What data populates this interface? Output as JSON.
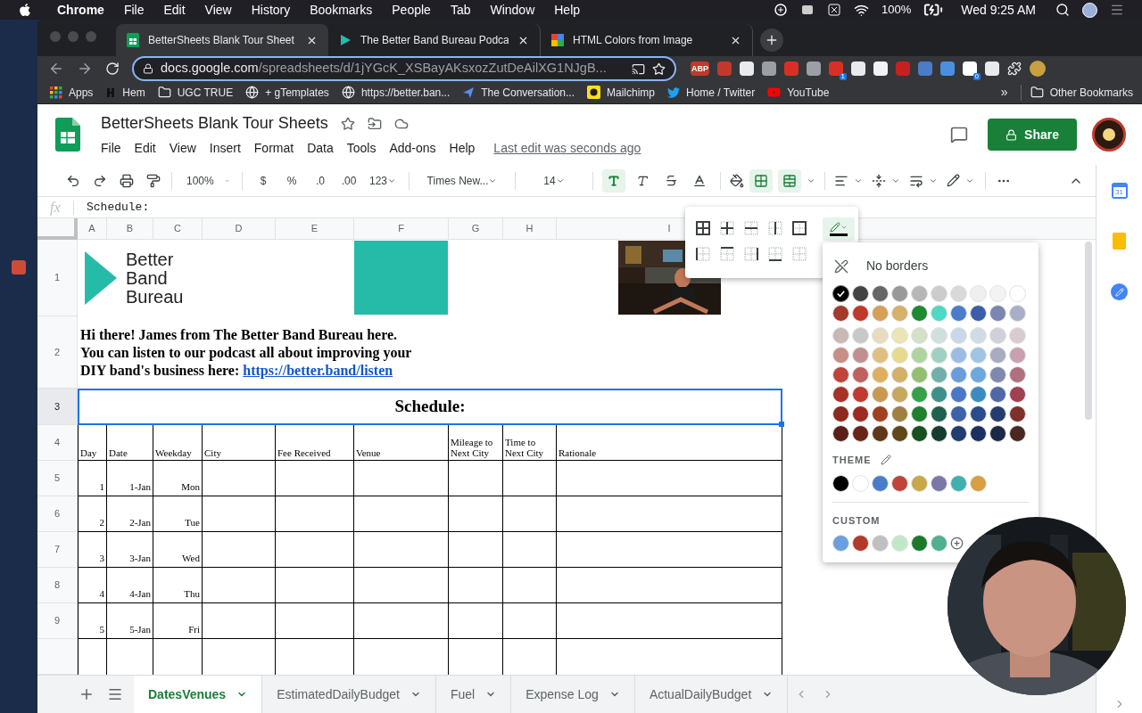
{
  "menubar": {
    "app": "Chrome",
    "menus": [
      "File",
      "Edit",
      "View",
      "History",
      "Bookmarks",
      "People",
      "Tab",
      "Window",
      "Help"
    ],
    "battery": "100%",
    "clock": "Wed 9:25 AM"
  },
  "browser": {
    "tabs": [
      {
        "title": "BetterSheets Blank Tour Sheet",
        "selected": true,
        "kind": "sheets"
      },
      {
        "title": "The Better Band Bureau Podca",
        "selected": false,
        "kind": "play"
      },
      {
        "title": "HTML Colors from Image",
        "selected": false,
        "kind": "colors"
      }
    ],
    "url_host": "docs.google.com",
    "url_path": "/spreadsheets/d/1jYGcK_XSBayAKsxozZutDeAilXG1NJgB...",
    "extensions": [
      {
        "color": "#c0392b",
        "label": "ABP"
      },
      {
        "color": "#c0392b"
      },
      {
        "color": "#e8eaed"
      },
      {
        "color": "#9aa0a6"
      },
      {
        "color": "#d93025"
      },
      {
        "color": "#9aa0a6"
      },
      {
        "color": "#d93025",
        "badge": "1"
      },
      {
        "color": "#e8eaed"
      },
      {
        "color": "#f1f3f4"
      },
      {
        "color": "#c5221f"
      },
      {
        "color": "#4a7cc8"
      },
      {
        "color": "#4a90e2"
      },
      {
        "color": "#ffffff",
        "badge": "0"
      },
      {
        "color": "#e8eaed"
      }
    ],
    "bookmarks": [
      {
        "label": "Apps",
        "kind": "apps"
      },
      {
        "label": "Hem",
        "kind": "mark"
      },
      {
        "label": "UGC TRUE",
        "kind": "folder"
      },
      {
        "label": "+ gTemplates",
        "kind": "globe"
      },
      {
        "label": "https://better.ban...",
        "kind": "globe"
      },
      {
        "label": "The Conversation...",
        "kind": "arrow"
      },
      {
        "label": "Mailchimp",
        "kind": "mail"
      },
      {
        "label": "Home / Twitter",
        "kind": "bird"
      },
      {
        "label": "YouTube",
        "kind": "play"
      }
    ],
    "bookmarks_more": "»",
    "other_bookmarks": "Other Bookmarks"
  },
  "doc": {
    "title": "BetterSheets Blank Tour Sheets",
    "menus": [
      "File",
      "Edit",
      "View",
      "Insert",
      "Format",
      "Data",
      "Tools",
      "Add-ons",
      "Help"
    ],
    "last_edit": "Last edit was seconds ago",
    "share": "Share"
  },
  "toolbar": {
    "zoom": "100%",
    "currency": "$",
    "percent": "%",
    "decimal_less": ".0",
    "decimal_more": ".00",
    "number_format": "123",
    "font": "Times New...",
    "size": "14",
    "bold": true,
    "italic": false,
    "strikethrough": false,
    "borders": true,
    "merge": true
  },
  "formula": {
    "fx": "fx",
    "value": "Schedule:"
  },
  "columns": [
    "A",
    "B",
    "C",
    "D",
    "E",
    "F",
    "G",
    "H",
    "I"
  ],
  "row_numbers": [
    {
      "label": "1",
      "selected": false
    },
    {
      "label": "2",
      "selected": false
    },
    {
      "label": "3",
      "selected": true
    },
    {
      "label": "4",
      "selected": false
    },
    {
      "label": "5",
      "selected": false
    },
    {
      "label": "6",
      "selected": false
    },
    {
      "label": "7",
      "selected": false
    },
    {
      "label": "8",
      "selected": false
    },
    {
      "label": "9",
      "selected": false
    }
  ],
  "logo": "Better Band Bureau",
  "intro": {
    "text": "Hi there! James from The Better Band Bureau here. You can listen to our podcast all about improving your DIY band's business here:",
    "link": "https://better.band/listen"
  },
  "schedule_title": "Schedule:",
  "headers": [
    "Day",
    "Date",
    "Weekday",
    "City",
    "Fee Received",
    "Venue",
    "Mileage to Next City",
    "Time to Next City",
    "Rationale"
  ],
  "data_rows": [
    [
      "1",
      "1-Jan",
      "Mon"
    ],
    [
      "2",
      "2-Jan",
      "Tue"
    ],
    [
      "3",
      "3-Jan",
      "Wed"
    ],
    [
      "4",
      "4-Jan",
      "Thu"
    ],
    [
      "5",
      "5-Jan",
      "Fri"
    ]
  ],
  "sheet_tabs": [
    {
      "name": "DatesVenues",
      "selected": true
    },
    {
      "name": "EstimatedDailyBudget",
      "selected": false
    },
    {
      "name": "Fuel",
      "selected": false
    },
    {
      "name": "Expense Log",
      "selected": false
    },
    {
      "name": "ActualDailyBudget",
      "selected": false
    }
  ],
  "calendar_day": "31",
  "border_menu": {
    "no_borders": "No borders",
    "theme_label": "THEME",
    "custom_label": "CUSTOM",
    "palette": [
      [
        {
          "color": "#000000",
          "selected": true
        },
        {
          "color": "#434343",
          "selected": false
        },
        {
          "color": "#666666",
          "selected": false
        },
        {
          "color": "#999999",
          "selected": false
        },
        {
          "color": "#b7b7b7",
          "selected": false
        },
        {
          "color": "#cccccc",
          "selected": false
        },
        {
          "color": "#d9d9d9",
          "selected": false
        },
        {
          "color": "#efefef",
          "selected": false
        },
        {
          "color": "#f3f3f3",
          "selected": false
        },
        {
          "color": "#ffffff",
          "selected": false
        }
      ],
      [
        {
          "color": "#a33a2c",
          "selected": false
        },
        {
          "color": "#c0392b",
          "selected": false
        },
        {
          "color": "#d4a05a",
          "selected": false
        },
        {
          "color": "#d4b26a",
          "selected": false
        },
        {
          "color": "#1e8a34",
          "selected": false
        },
        {
          "color": "#4fd8c4",
          "selected": false
        },
        {
          "color": "#4a7ccc",
          "selected": false
        },
        {
          "color": "#3a5fa8",
          "selected": false
        },
        {
          "color": "#7a86b0",
          "selected": false
        },
        {
          "color": "#a9aec8",
          "selected": false
        }
      ],
      [
        {
          "color": "#c9b8b5",
          "selected": false
        },
        {
          "color": "#c8c8c8",
          "selected": false
        },
        {
          "color": "#e8dcc0",
          "selected": false
        },
        {
          "color": "#ebe5b5",
          "selected": false
        },
        {
          "color": "#d4e0c8",
          "selected": false
        },
        {
          "color": "#cfe0dc",
          "selected": false
        },
        {
          "color": "#c8d8e8",
          "selected": false
        },
        {
          "color": "#cfdce8",
          "selected": false
        },
        {
          "color": "#d0d0d8",
          "selected": false
        },
        {
          "color": "#d8ccd0",
          "selected": false
        }
      ],
      [
        {
          "color": "#c88f86",
          "selected": false
        },
        {
          "color": "#c09090",
          "selected": false
        },
        {
          "color": "#e0c080",
          "selected": false
        },
        {
          "color": "#e6da8e",
          "selected": false
        },
        {
          "color": "#b0d4a0",
          "selected": false
        },
        {
          "color": "#a0d0c4",
          "selected": false
        },
        {
          "color": "#9cbce4",
          "selected": false
        },
        {
          "color": "#a0c4e4",
          "selected": false
        },
        {
          "color": "#a8acc0",
          "selected": false
        },
        {
          "color": "#c8a0b0",
          "selected": false
        }
      ],
      [
        {
          "color": "#c0443a",
          "selected": false
        },
        {
          "color": "#c06060",
          "selected": false
        },
        {
          "color": "#dcb060",
          "selected": false
        },
        {
          "color": "#d4b068",
          "selected": false
        },
        {
          "color": "#90c070",
          "selected": false
        },
        {
          "color": "#70b0a8",
          "selected": false
        },
        {
          "color": "#6a9cdc",
          "selected": false
        },
        {
          "color": "#6ca8dc",
          "selected": false
        },
        {
          "color": "#8088b0",
          "selected": false
        },
        {
          "color": "#b07080",
          "selected": false
        }
      ],
      [
        {
          "color": "#a83228",
          "selected": false
        },
        {
          "color": "#c03a30",
          "selected": false
        },
        {
          "color": "#c89a50",
          "selected": false
        },
        {
          "color": "#c8a860",
          "selected": false
        },
        {
          "color": "#38a048",
          "selected": false
        },
        {
          "color": "#40908a",
          "selected": false
        },
        {
          "color": "#4a78c8",
          "selected": false
        },
        {
          "color": "#3a8cc0",
          "selected": false
        },
        {
          "color": "#5068a8",
          "selected": false
        },
        {
          "color": "#a04050",
          "selected": false
        }
      ],
      [
        {
          "color": "#8c2a20",
          "selected": false
        },
        {
          "color": "#9c2a20",
          "selected": false
        },
        {
          "color": "#a04020",
          "selected": false
        },
        {
          "color": "#a08040",
          "selected": false
        },
        {
          "color": "#208030",
          "selected": false
        },
        {
          "color": "#206050",
          "selected": false
        },
        {
          "color": "#3c62a8",
          "selected": false
        },
        {
          "color": "#2a4c8c",
          "selected": false
        },
        {
          "color": "#243c70",
          "selected": false
        },
        {
          "color": "#80302a",
          "selected": false
        }
      ],
      [
        {
          "color": "#5a2018",
          "selected": false
        },
        {
          "color": "#6a2418",
          "selected": false
        },
        {
          "color": "#603818",
          "selected": false
        },
        {
          "color": "#604818",
          "selected": false
        },
        {
          "color": "#185020",
          "selected": false
        },
        {
          "color": "#183c30",
          "selected": false
        },
        {
          "color": "#203c70",
          "selected": false
        },
        {
          "color": "#1c3060",
          "selected": false
        },
        {
          "color": "#1c2848",
          "selected": false
        },
        {
          "color": "#4a2820",
          "selected": false
        }
      ]
    ],
    "theme": [
      {
        "color": "#000000",
        "selected": false
      },
      {
        "color": "#ffffff",
        "selected": false
      },
      {
        "color": "#4a7cc8",
        "selected": false
      },
      {
        "color": "#c0443a",
        "selected": false
      },
      {
        "color": "#c8a848",
        "selected": false
      },
      {
        "color": "#7a78a8",
        "selected": false
      },
      {
        "color": "#40b0b0",
        "selected": false
      },
      {
        "color": "#d8a040",
        "selected": false
      }
    ],
    "custom": [
      {
        "color": "#6aa0e0",
        "selected": false
      },
      {
        "color": "#b03a2c",
        "selected": false
      },
      {
        "color": "#c0c0c0",
        "selected": false
      },
      {
        "color": "#c0e8c8",
        "selected": false
      },
      {
        "color": "#1a7a2a",
        "selected": false
      },
      {
        "color": "#50b090",
        "selected": false
      }
    ]
  }
}
